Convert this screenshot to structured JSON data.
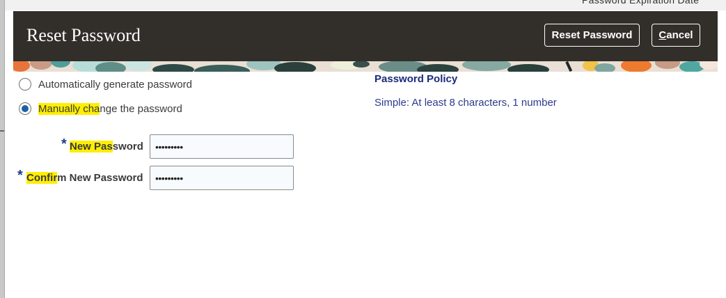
{
  "background": {
    "partial_text": "Password Expiration Date"
  },
  "dialog": {
    "title": "Reset Password",
    "reset_button_label": "Reset Password",
    "cancel_button": {
      "underlined_letter": "C",
      "rest": "ancel"
    }
  },
  "options": {
    "auto_generate": {
      "label": "Automatically generate password",
      "selected": false
    },
    "manual": {
      "label_part1": "Manually cha",
      "label_part2": "nge the password",
      "selected": true
    }
  },
  "fields": {
    "required_mark": "*",
    "new_password": {
      "label_hl": "New Pas",
      "label_rest": "sword",
      "value": "•••••••••"
    },
    "confirm_password": {
      "label_hl": "Confir",
      "label_rest": "m New Password",
      "value": "•••••••••"
    }
  },
  "policy": {
    "title": "Password Policy",
    "text": "Simple: At least 8 characters, 1 number"
  },
  "colors": {
    "header_bg": "#322f2b",
    "highlight": "#ffee00",
    "radio_selected": "#1b5fa8",
    "policy_text": "#2c3a8c"
  }
}
